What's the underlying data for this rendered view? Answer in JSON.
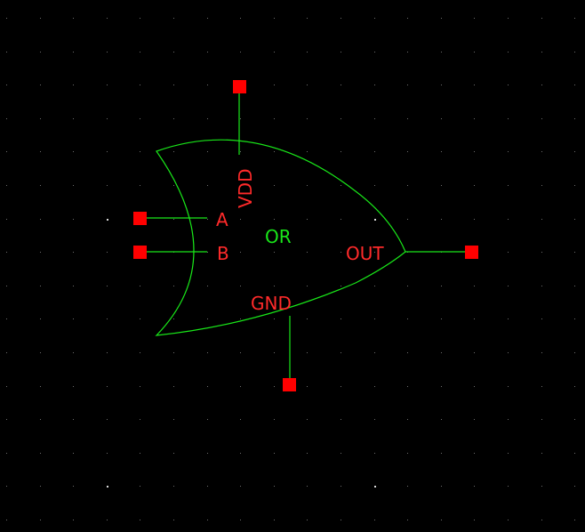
{
  "colors": {
    "background": "#000000",
    "grid_dot": "#6e6e6e",
    "grid_dot_major": "#d8d8d8",
    "wire": "#19e619",
    "pin": "#ff0000",
    "pin_label": "#ff2a2a",
    "symbol_label": "#19e619"
  },
  "symbol": {
    "name": "OR"
  },
  "pins": {
    "vdd": "VDD",
    "a": "A",
    "b": "B",
    "out": "OUT",
    "gnd": "GND"
  }
}
